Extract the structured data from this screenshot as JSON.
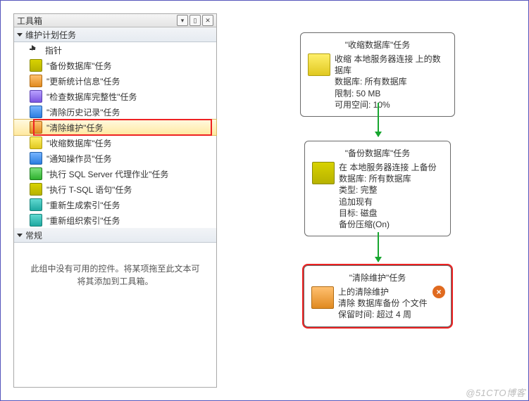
{
  "toolbox": {
    "title": "工具箱",
    "sections": {
      "plan": {
        "label": "维护计划任务",
        "pointer_label": "指针",
        "items": [
          {
            "label": "\"备份数据库\"任务",
            "icon": "ic-db"
          },
          {
            "label": "\"更新统计信息\"任务",
            "icon": "ic-orange"
          },
          {
            "label": "\"检查数据库完整性\"任务",
            "icon": "ic-purple"
          },
          {
            "label": "\"清除历史记录\"任务",
            "icon": "ic-blue"
          },
          {
            "label": "\"清除维护\"任务",
            "icon": "ic-orange",
            "selected": true
          },
          {
            "label": "\"收缩数据库\"任务",
            "icon": "ic-yellow"
          },
          {
            "label": "\"通知操作员\"任务",
            "icon": "ic-blue"
          },
          {
            "label": "\"执行 SQL Server 代理作业\"任务",
            "icon": "ic-green"
          },
          {
            "label": "\"执行 T-SQL 语句\"任务",
            "icon": "ic-db"
          },
          {
            "label": "\"重新生成索引\"任务",
            "icon": "ic-teal"
          },
          {
            "label": "\"重新组织索引\"任务",
            "icon": "ic-teal"
          }
        ]
      },
      "general": {
        "label": "常规",
        "empty_text": "此组中没有可用的控件。将某项拖至此文本可将其添加到工具箱。"
      }
    }
  },
  "flow": {
    "tasks": {
      "shrink": {
        "title": "\"收缩数据库\"任务",
        "lines": [
          "收缩 本地服务器连接 上的数据库",
          "数据库: 所有数据库",
          "限制: 50 MB",
          "可用空间: 10%"
        ]
      },
      "backup": {
        "title": "\"备份数据库\"任务",
        "lines": [
          "在 本地服务器连接 上备份",
          "数据库: 所有数据库",
          "类型: 完整",
          "追加现有",
          "目标: 磁盘",
          "备份压缩(On)"
        ]
      },
      "cleanup": {
        "title": "\"清除维护\"任务",
        "lines": [
          " 上的清除维护",
          "清除 数据库备份  个文件",
          "保留时间: 超过 4 周"
        ],
        "error": "×"
      }
    }
  },
  "watermark": "@51CTO博客"
}
